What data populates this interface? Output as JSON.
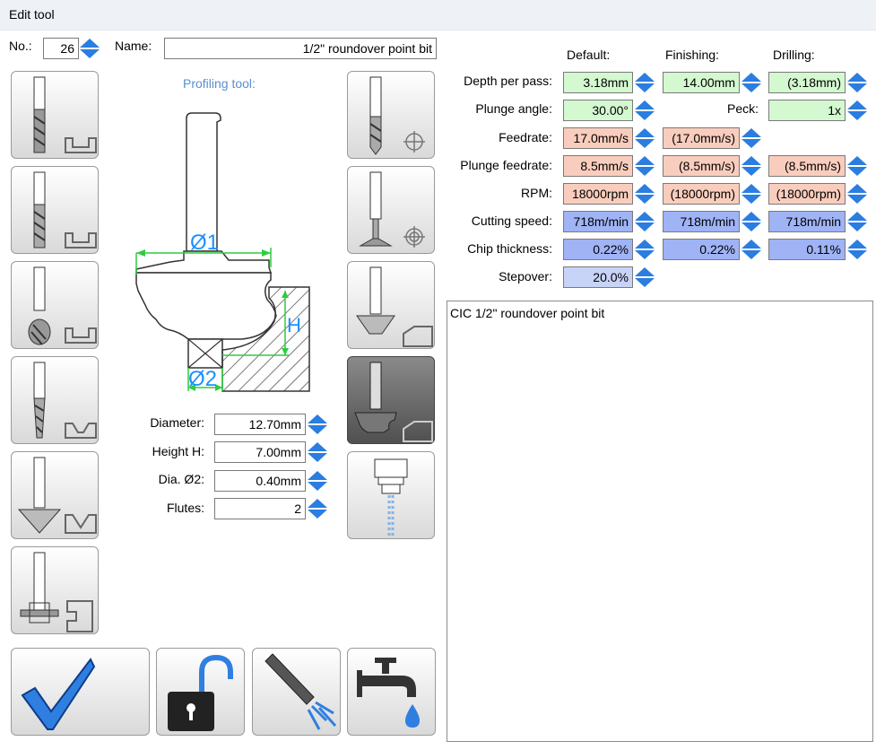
{
  "window": {
    "title": "Edit tool"
  },
  "tool": {
    "no_label": "No.:",
    "no_value": "26",
    "name_label": "Name:",
    "name_value": "1/2\" roundover point bit",
    "profiling_label": "Profiling tool:"
  },
  "diagram": {
    "d1_label": "Ø1",
    "d2_label": "Ø2",
    "h_label": "H",
    "accent_color": "#1e90ff",
    "dimension_color": "#2ecc40"
  },
  "geometry": {
    "rows": [
      {
        "label": "Diameter:",
        "value": "12.70mm"
      },
      {
        "label": "Height H:",
        "value": "7.00mm"
      },
      {
        "label": "Dia. Ø2:",
        "value": "0.40mm"
      },
      {
        "label": "Flutes:",
        "value": "2"
      }
    ]
  },
  "params": {
    "headers": {
      "default": "Default:",
      "finishing": "Finishing:",
      "drilling": "Drilling:"
    },
    "depth_per_pass": {
      "label": "Depth per pass:",
      "default": "3.18mm",
      "finishing": "14.00mm",
      "drilling": "(3.18mm)"
    },
    "plunge_angle": {
      "label": "Plunge angle:",
      "default": "30.00°"
    },
    "peck": {
      "label": "Peck:",
      "drilling": "1x"
    },
    "feedrate": {
      "label": "Feedrate:",
      "default": "17.0mm/s",
      "finishing": "(17.0mm/s)"
    },
    "plunge_feedrate": {
      "label": "Plunge feedrate:",
      "default": "8.5mm/s",
      "finishing": "(8.5mm/s)",
      "drilling": "(8.5mm/s)"
    },
    "rpm": {
      "label": "RPM:",
      "default": "18000rpm",
      "finishing": "(18000rpm)",
      "drilling": "(18000rpm)"
    },
    "cutting_speed": {
      "label": "Cutting speed:",
      "default": "718m/min",
      "finishing": "718m/min",
      "drilling": "718m/min"
    },
    "chip_thickness": {
      "label": "Chip thickness:",
      "default": "0.22%",
      "finishing": "0.22%",
      "drilling": "0.11%"
    },
    "stepover": {
      "label": "Stepover:",
      "default": "20.0%"
    }
  },
  "description": "CIC 1/2\" roundover point bit",
  "colors": {
    "green": "#d4f8cf",
    "salmon": "#f9cdbd",
    "blue": "#9fb3f5",
    "spin_blue": "#2b7de0",
    "confirm_blue": "#2f7fe0"
  },
  "icons": {
    "tool_types_left": [
      "flat-endmill-icon",
      "flat-endmill-long-icon",
      "ballnose-endmill-icon",
      "tapered-endmill-icon",
      "v-bit-icon",
      "slot-cutter-icon"
    ],
    "tool_types_right": [
      "drill-icon",
      "center-drill-icon",
      "chamfer-bit-icon",
      "profiling-bit-icon",
      "spindle-icon"
    ],
    "bottom": [
      "checkmark-icon",
      "unlock-icon",
      "air-blast-icon",
      "coolant-tap-icon"
    ]
  }
}
